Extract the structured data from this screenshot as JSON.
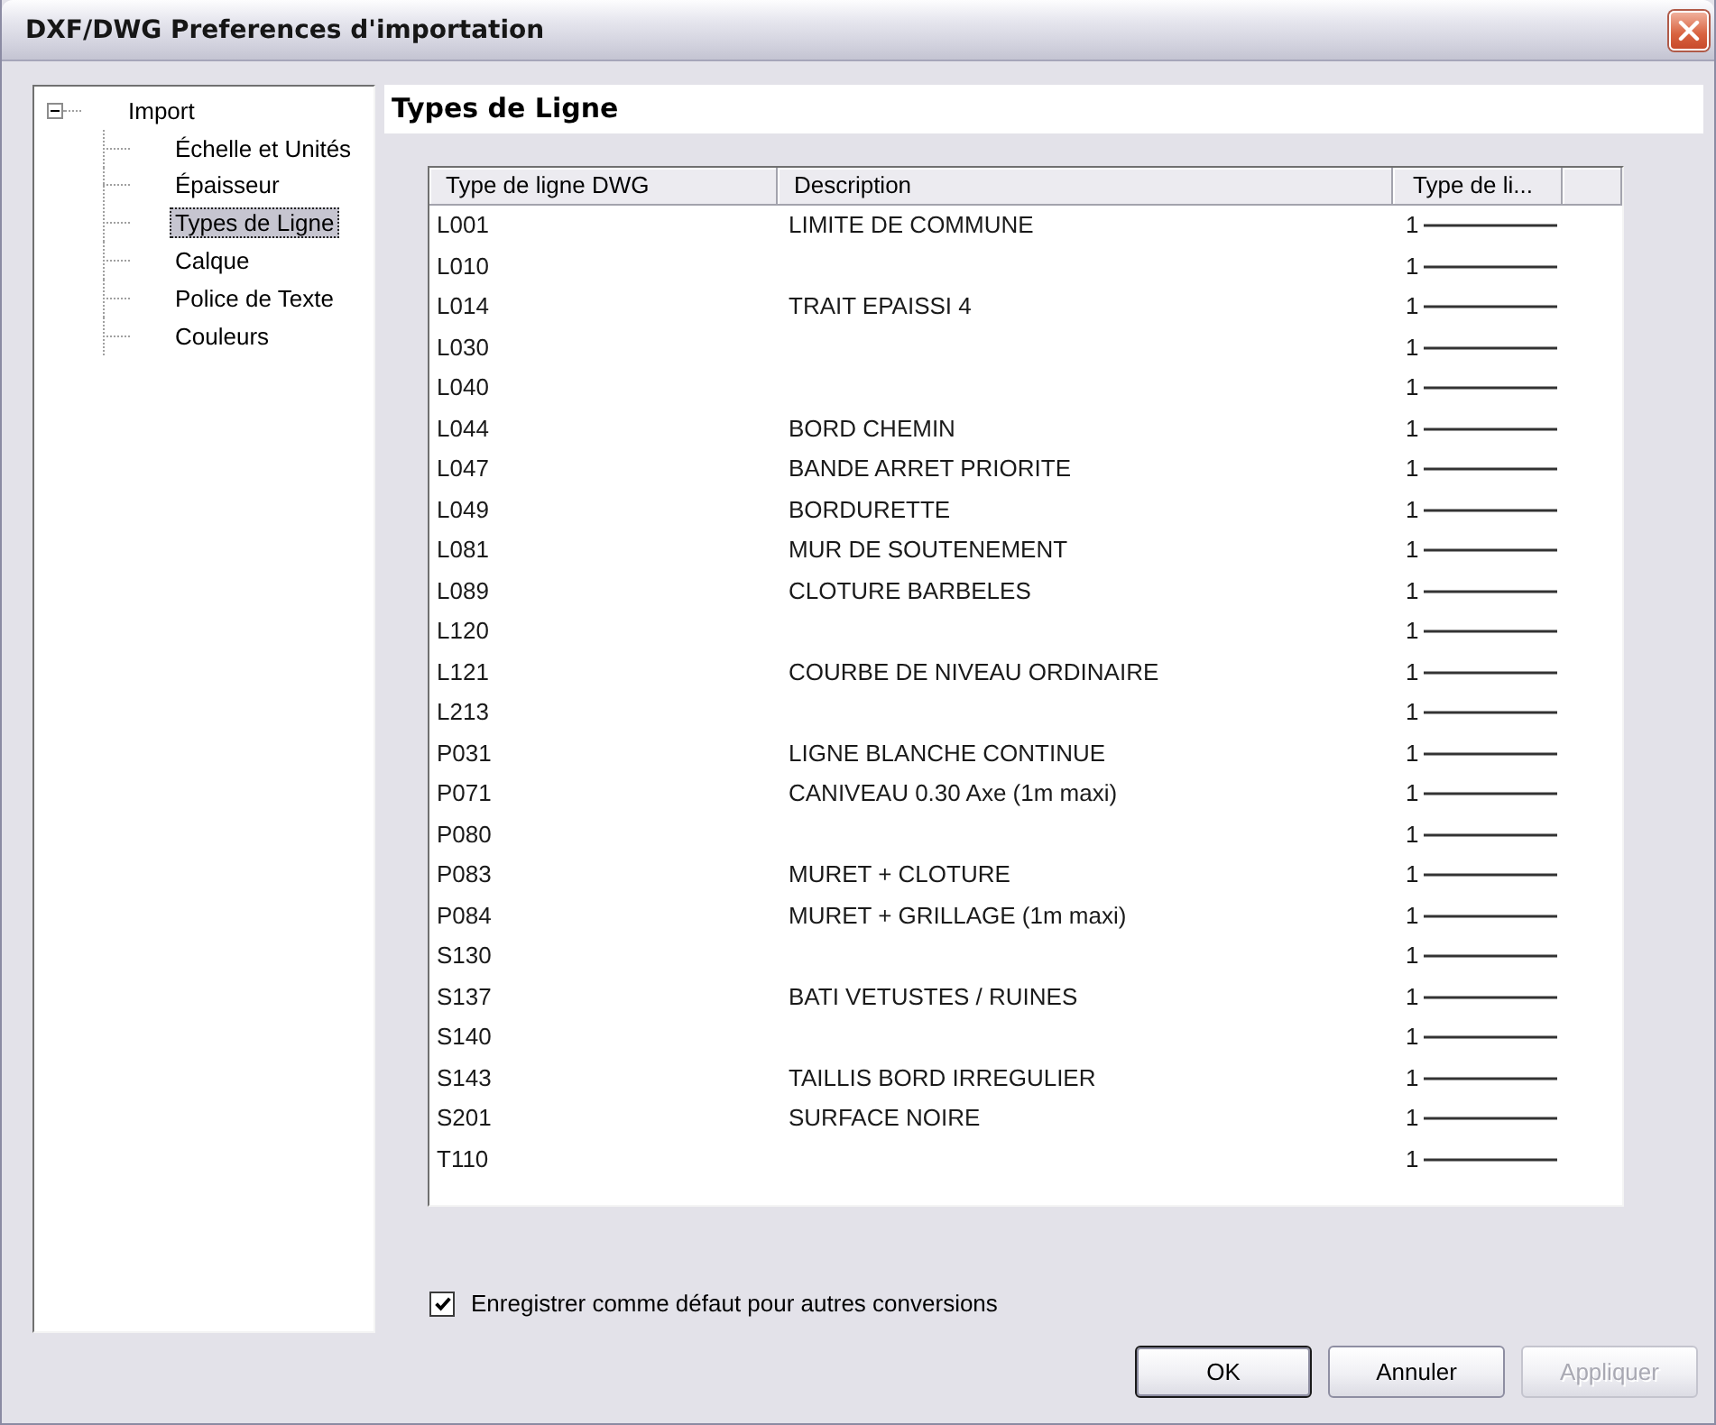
{
  "window": {
    "title": "DXF/DWG Preferences d'importation"
  },
  "tree": [
    {
      "label": "Import",
      "expanded": true,
      "selected": false,
      "children": [
        {
          "label": "Échelle et Unités",
          "selected": false
        },
        {
          "label": "Épaisseur",
          "selected": false
        },
        {
          "label": "Types de Ligne",
          "selected": true
        },
        {
          "label": "Calque",
          "selected": false
        },
        {
          "label": "Police de Texte",
          "selected": false
        },
        {
          "label": "Couleurs",
          "selected": false
        }
      ]
    }
  ],
  "panel": {
    "title": "Types de Ligne"
  },
  "table": {
    "columns": [
      "Type de ligne DWG",
      "Description",
      "Type de li..."
    ],
    "rows": [
      {
        "code": "L001",
        "description": "LIMITE DE COMMUNE",
        "line_type": "1"
      },
      {
        "code": "L010",
        "line_type": "1"
      },
      {
        "code": "L014",
        "description": "TRAIT EPAISSI 4",
        "line_type": "1"
      },
      {
        "code": "L030",
        "line_type": "1"
      },
      {
        "code": "L040",
        "line_type": "1"
      },
      {
        "code": "L044",
        "description": "BORD CHEMIN",
        "line_type": "1"
      },
      {
        "code": "L047",
        "description": "BANDE ARRET PRIORITE",
        "line_type": "1"
      },
      {
        "code": "L049",
        "description": "BORDURETTE",
        "line_type": "1"
      },
      {
        "code": "L081",
        "description": "MUR DE SOUTENEMENT",
        "line_type": "1"
      },
      {
        "code": "L089",
        "description": "CLOTURE BARBELES",
        "line_type": "1"
      },
      {
        "code": "L120",
        "line_type": "1"
      },
      {
        "code": "L121",
        "description": "COURBE DE NIVEAU ORDINAIRE",
        "line_type": "1"
      },
      {
        "code": "L213",
        "line_type": "1"
      },
      {
        "code": "P031",
        "description": "LIGNE BLANCHE CONTINUE",
        "line_type": "1"
      },
      {
        "code": "P071",
        "description": "CANIVEAU 0.30 Axe (1m maxi)",
        "line_type": "1"
      },
      {
        "code": "P080",
        "line_type": "1"
      },
      {
        "code": "P083",
        "description": "MURET + CLOTURE",
        "line_type": "1"
      },
      {
        "code": "P084",
        "description": "MURET + GRILLAGE (1m maxi)",
        "line_type": "1"
      },
      {
        "code": "S130",
        "line_type": "1"
      },
      {
        "code": "S137",
        "description": "BATI VETUSTES / RUINES",
        "line_type": "1"
      },
      {
        "code": "S140",
        "line_type": "1"
      },
      {
        "code": "S143",
        "description": "TAILLIS BORD IRREGULIER",
        "line_type": "1"
      },
      {
        "code": "S201",
        "description": "SURFACE NOIRE",
        "line_type": "1"
      },
      {
        "code": "T110",
        "line_type": "1"
      }
    ]
  },
  "save_default": {
    "label": "Enregistrer comme défaut pour autres conversions",
    "checked": true
  },
  "buttons": [
    {
      "label": "OK",
      "default": true,
      "disabled": false
    },
    {
      "label": "Annuler",
      "default": false,
      "disabled": false
    },
    {
      "label": "Appliquer",
      "default": false,
      "disabled": true
    }
  ]
}
